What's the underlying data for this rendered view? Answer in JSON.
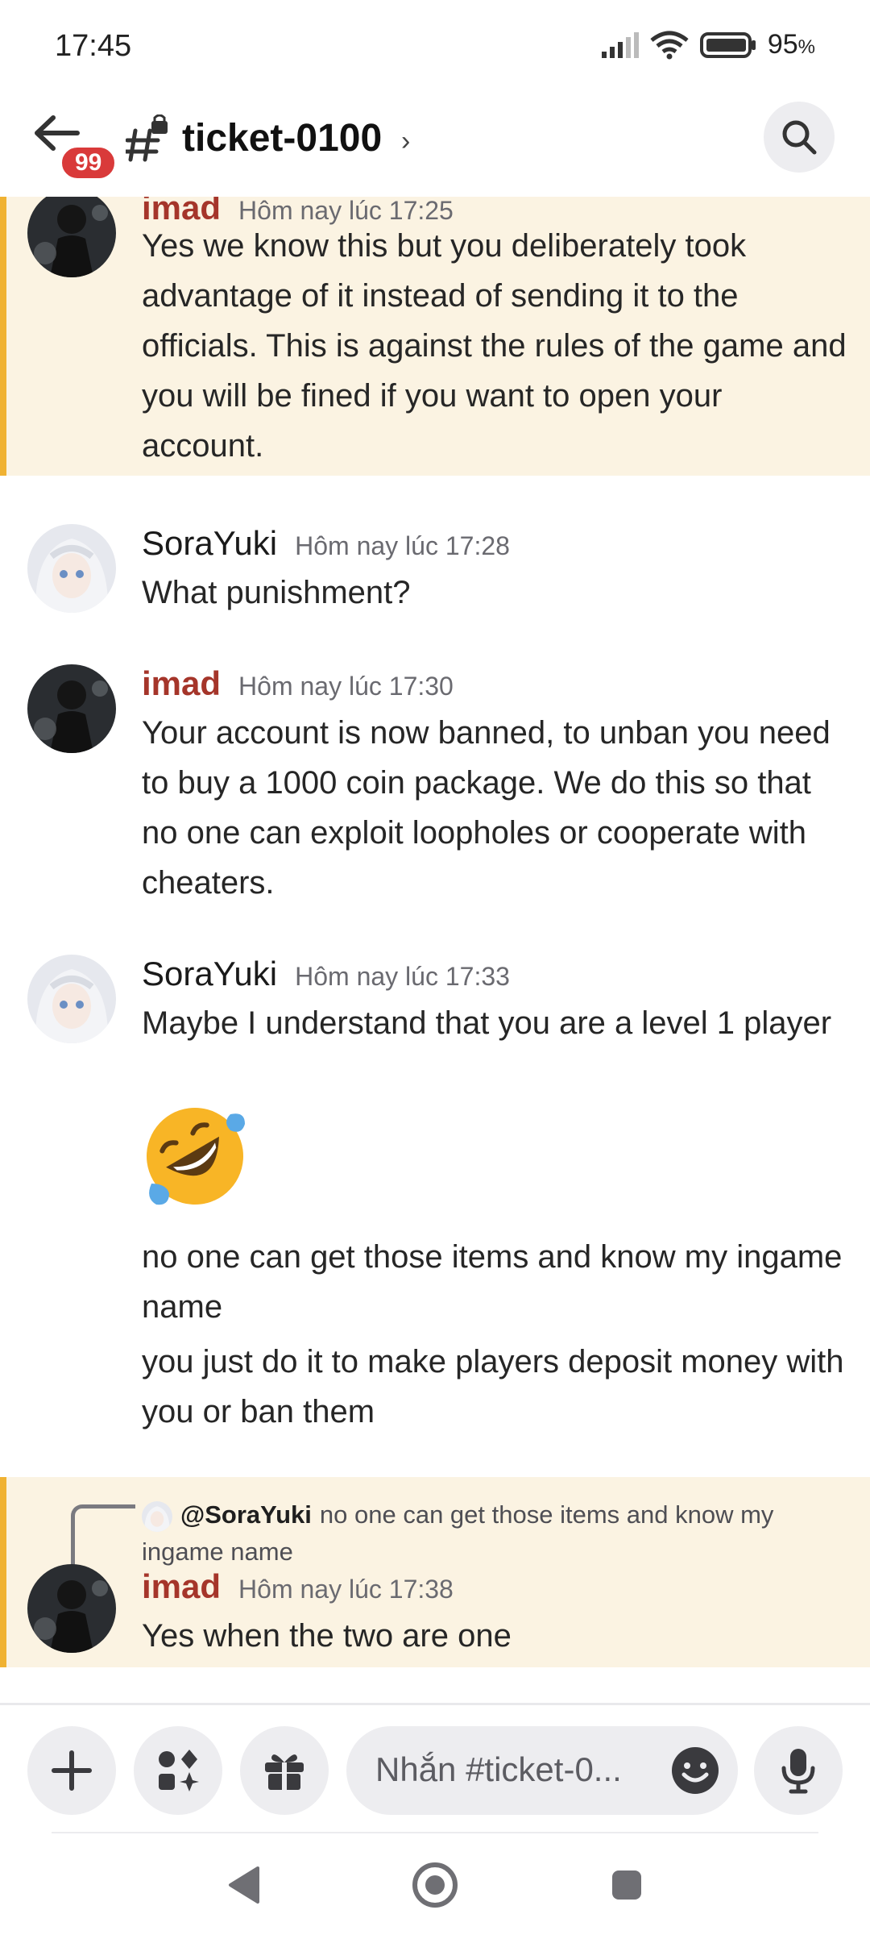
{
  "status_bar": {
    "time": "17:45",
    "battery": "95"
  },
  "header": {
    "unread_count": "99",
    "channel_name": "ticket-0100",
    "chevron": "›",
    "icons": [
      "back-arrow-icon",
      "locked-channel-icon",
      "search-icon"
    ]
  },
  "messages": [
    {
      "author": "imad",
      "timestamp": "Hôm nay lúc 17:25",
      "lines": [
        "Yes we know this but you deliberately took advantage of it instead of sending it to the officials. This is against the rules of the game and you will be fined if you want to open your account."
      ]
    },
    {
      "author": "SoraYuki",
      "timestamp": "Hôm nay lúc 17:28",
      "lines": [
        "What punishment?"
      ]
    },
    {
      "author": "imad",
      "timestamp": "Hôm nay lúc 17:30",
      "lines": [
        "Your account is now banned, to unban you need to buy a 1000 coin package. We do this so that no one can exploit loopholes or cooperate with cheaters."
      ]
    },
    {
      "author": "SoraYuki",
      "timestamp": "Hôm nay lúc 17:33",
      "lines": [
        "Maybe I understand that you are a level 1 player",
        "no one can get those items and know my ingame name",
        "you just do it to make players deposit money with you or ban them"
      ],
      "emoji": "rolling-on-floor-laughing-emoji"
    },
    {
      "author": "imad",
      "timestamp": "Hôm nay lúc 17:38",
      "reply_to": {
        "author": "@SoraYuki",
        "text": "no one can get those items and know my ingame name"
      },
      "lines": [
        "Yes when the two are one"
      ]
    }
  ],
  "composer": {
    "placeholder": "Nhắn #ticket-0...",
    "icons": [
      "plus-icon",
      "apps-icon",
      "gift-icon",
      "emoji-icon",
      "microphone-icon"
    ]
  },
  "navbar": {
    "icons": [
      "back-triangle-icon",
      "home-circle-icon",
      "recents-square-icon"
    ]
  },
  "colors": {
    "highlight_bg": "#fbf3e2",
    "highlight_border": "#f0b232",
    "imad_name": "#a5352a",
    "badge": "#d93a3a"
  }
}
